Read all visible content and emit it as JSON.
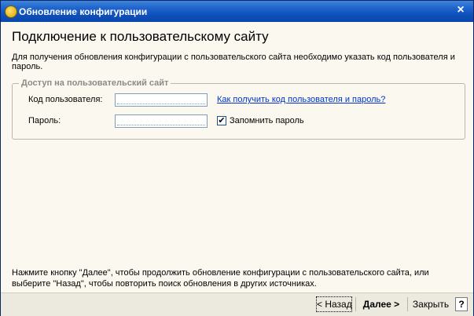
{
  "window": {
    "title": "Обновление конфигурации",
    "close_glyph": "×"
  },
  "page": {
    "title": "Подключение к пользовательскому сайту",
    "description": "Для получения обновления конфигурации с пользовательского сайта необходимо указать код пользователя и пароль."
  },
  "access_group": {
    "legend": "Доступ на пользовательский сайт",
    "user_code_label": "Код пользователя:",
    "user_code_value": "",
    "password_label": "Пароль:",
    "password_value": "",
    "help_link": "Как получить код пользователя и пароль?",
    "remember_label": "Запомнить пароль",
    "remember_checked": true,
    "check_glyph": "✔"
  },
  "footer_note": "Нажмите кнопку \"Далее\", чтобы продолжить обновление конфигурации с пользовательского сайта, или выберите \"Назад\", чтобы повторить поиск обновления в других источниках.",
  "buttons": {
    "back": "< Назад",
    "next": "Далее >",
    "close": "Закрыть",
    "help": "?"
  }
}
